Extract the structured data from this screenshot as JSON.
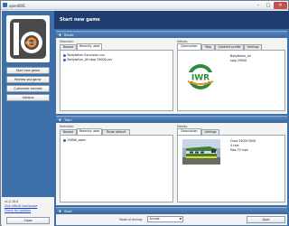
{
  "window": {
    "title": "openBVE"
  },
  "sidebar": {
    "logo_text": "open",
    "buttons": [
      "Start new game",
      "Review last game",
      "Customize controls",
      "Options"
    ],
    "version": "v1.2.10.0",
    "links": [
      "Visit official homepage",
      "Check for updates"
    ],
    "close_label": "Close"
  },
  "header": {
    "title": "Start new game"
  },
  "route": {
    "section_label": "Route",
    "selection_label": "Selection:",
    "details_label": "Details:",
    "selection_tabs": [
      "Browse",
      "Recently used"
    ],
    "active_selection_tab": 1,
    "files": [
      "Ballykelvin Excursion.csv",
      "Ballykelvin_All stop 29000.csv"
    ],
    "detail_tabs": [
      "Description",
      "Map",
      "Gradient profile",
      "Settings"
    ],
    "description": [
      "Ballykelvin_All",
      "stop 29000"
    ],
    "image_logo_text": "IWR"
  },
  "train": {
    "section_label": "Train",
    "selection_label": "Selection:",
    "details_label": "Details:",
    "selection_tabs": [
      "Browse",
      "Recently used",
      "Route default"
    ],
    "active_selection_tab": 1,
    "files": [
      "29000_open"
    ],
    "detail_tabs": [
      "Description",
      "Settings"
    ],
    "description": [
      "Class 29000 DMU",
      "4 cars",
      "Max 75 mph"
    ]
  },
  "start": {
    "section_label": "Start",
    "mode_label": "Mode of driving:",
    "mode_value": "Arcade",
    "start_label": "Start"
  },
  "colors": {
    "sidebar_blue": "#3d6fa8",
    "header_navy": "#1f3d6e",
    "iwr_green": "#2d8a3c",
    "iwr_orange": "#ef8a1e"
  }
}
